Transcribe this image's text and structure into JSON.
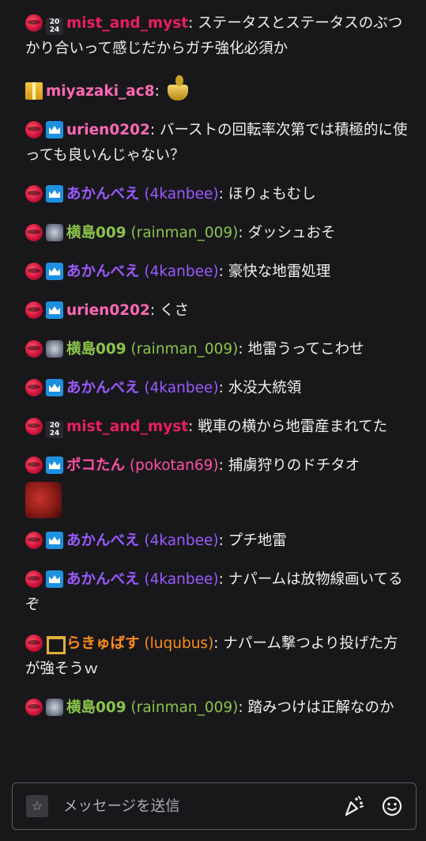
{
  "messages": [
    {
      "badges": [
        "red",
        "2024"
      ],
      "user": "mist_and_myst",
      "login": "",
      "color": "#e91e63",
      "text": "ステータスとステータスのぶつかり合いって感じだからガチ強化必須か",
      "emote": ""
    },
    {
      "badges": [
        "gift"
      ],
      "user": "miyazaki_ac8",
      "login": "",
      "color": "#ff69b4",
      "text": "",
      "emote": "cup-emote"
    },
    {
      "badges": [
        "red",
        "blue"
      ],
      "user": "urien0202",
      "login": "",
      "color": "#ff69b4",
      "text": "バーストの回転率次第では積極的に使っても良いんじゃない？",
      "emote": ""
    },
    {
      "badges": [
        "red",
        "blue"
      ],
      "user": "あかんべえ",
      "login": "(4kanbee)",
      "color": "#9b59ff",
      "text": "ほりょもむし",
      "emote": ""
    },
    {
      "badges": [
        "red",
        "robot"
      ],
      "user": "横島009",
      "login": "(rainman_009)",
      "color": "#8bc34a",
      "text": "ダッシュおそ",
      "emote": ""
    },
    {
      "badges": [
        "red",
        "blue"
      ],
      "user": "あかんべえ",
      "login": "(4kanbee)",
      "color": "#9b59ff",
      "text": "豪快な地雷処理",
      "emote": ""
    },
    {
      "badges": [
        "red",
        "blue"
      ],
      "user": "urien0202",
      "login": "",
      "color": "#ff69b4",
      "text": "くさ",
      "emote": ""
    },
    {
      "badges": [
        "red",
        "robot"
      ],
      "user": "横島009",
      "login": "(rainman_009)",
      "color": "#8bc34a",
      "text": "地雷うってこわせ",
      "emote": ""
    },
    {
      "badges": [
        "red",
        "blue"
      ],
      "user": "あかんべえ",
      "login": "(4kanbee)",
      "color": "#9b59ff",
      "text": "水没大統領",
      "emote": ""
    },
    {
      "badges": [
        "red",
        "2024"
      ],
      "user": "mist_and_myst",
      "login": "",
      "color": "#e91e63",
      "text": "戦車の横から地雷産まれてた",
      "emote": ""
    },
    {
      "badges": [
        "red",
        "blue"
      ],
      "user": "ポコたん",
      "login": "(pokotan69)",
      "color": "#ff4fa3",
      "text": "捕虜狩りのドチタオ",
      "emote": "face-emote"
    },
    {
      "badges": [
        "red",
        "blue"
      ],
      "user": "あかんべえ",
      "login": "(4kanbee)",
      "color": "#9b59ff",
      "text": "プチ地雷",
      "emote": ""
    },
    {
      "badges": [
        "red",
        "blue"
      ],
      "user": "あかんべえ",
      "login": "(4kanbee)",
      "color": "#9b59ff",
      "text": "ナパームは放物線画いてるぞ",
      "emote": ""
    },
    {
      "badges": [
        "red",
        "jp"
      ],
      "user": "らきゅばす",
      "login": "(luqubus)",
      "color": "#ff8c1a",
      "text": "ナパーム撃つより投げた方が強そうｗ",
      "emote": ""
    },
    {
      "badges": [
        "red",
        "robot"
      ],
      "user": "横島009",
      "login": "(rainman_009)",
      "color": "#8bc34a",
      "text": "踏みつけは正解なのか",
      "emote": ""
    }
  ],
  "badge_text": {
    "year_top": "20",
    "year_bottom": "24"
  },
  "separator": ": ",
  "input": {
    "placeholder": "メッセージを送信",
    "value": ""
  },
  "icons": {
    "emote_picker": "star-icon",
    "cheer": "party-popper-icon",
    "emoji": "smile-icon"
  },
  "colors": {
    "background": "#18181b",
    "text": "#efeff1",
    "muted": "#adadb8",
    "input_border": "#5a5a60"
  }
}
